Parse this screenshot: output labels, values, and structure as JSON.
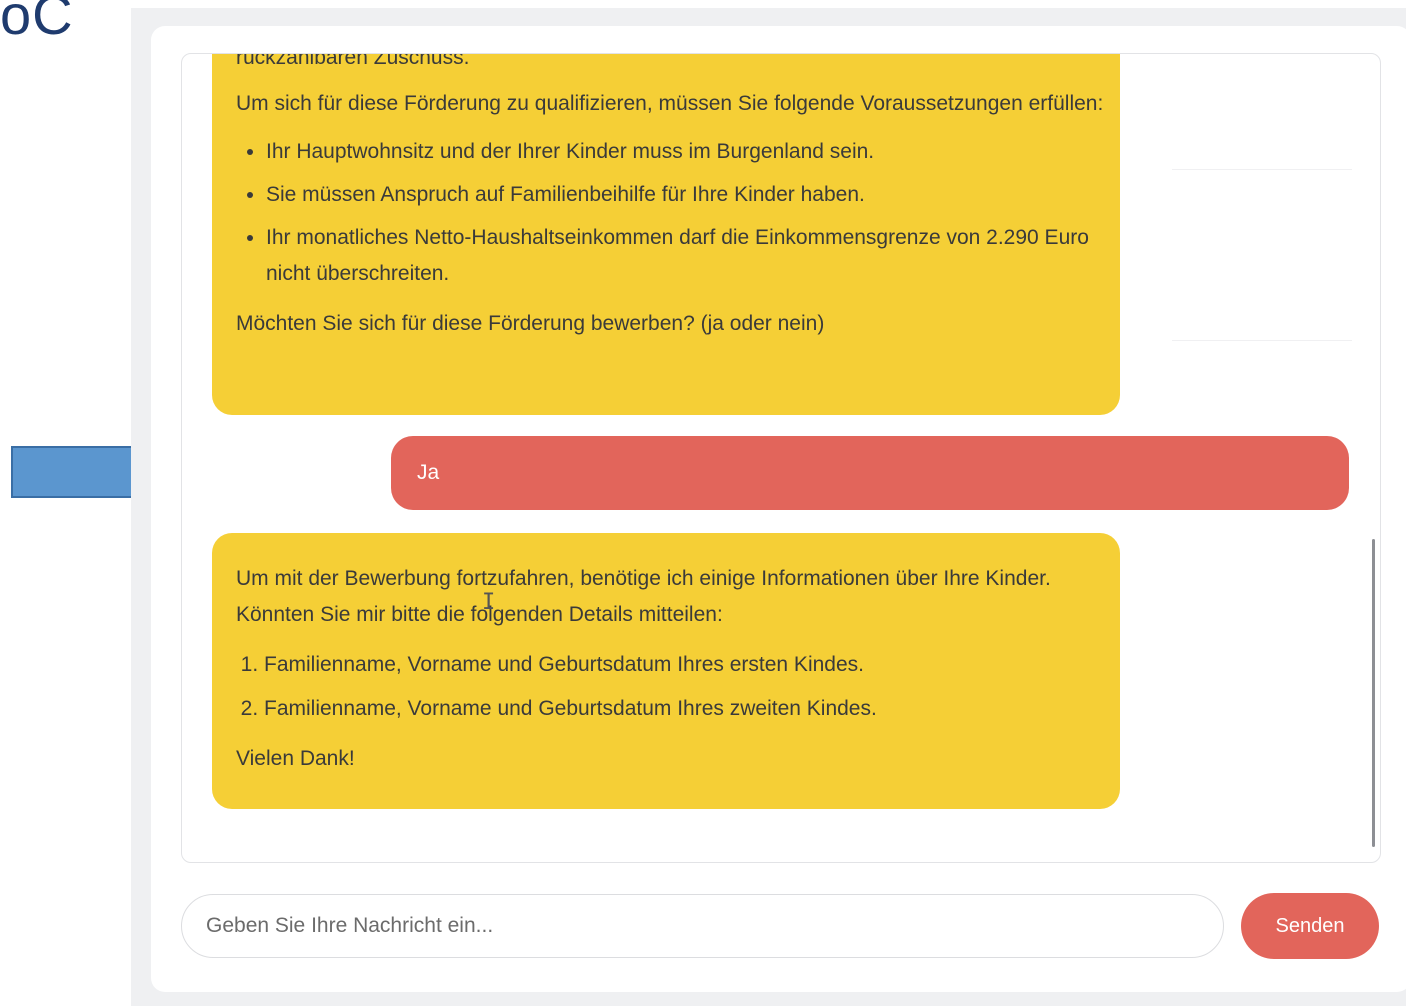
{
  "corner_label": "oC",
  "colors": {
    "bot_bubble": "#f5cf36",
    "user_bubble": "#e2655b",
    "send_button": "#e2655b",
    "arrow": "#5b96cf"
  },
  "messages": {
    "bot1": {
      "clipped_line": "rückzahlbaren Zuschuss.",
      "intro": "Um sich für diese Förderung zu qualifizieren, müssen Sie folgende Voraussetzungen erfüllen:",
      "bullets": [
        "Ihr Hauptwohnsitz und der Ihrer Kinder muss im Burgenland sein.",
        "Sie müssen Anspruch auf Familienbeihilfe für Ihre Kinder haben.",
        "Ihr monatliches Netto-Haushaltseinkommen darf die Einkommensgrenze von 2.290 Euro nicht überschreiten."
      ],
      "question": "Möchten Sie sich für diese Förderung bewerben? (ja oder nein)"
    },
    "user1": {
      "text": "Ja"
    },
    "bot2": {
      "intro": "Um mit der Bewerbung fortzufahren, benötige ich einige Informationen über Ihre Kinder. Könnten Sie mir bitte die folgenden Details mitteilen:",
      "items": [
        "Familienname, Vorname und Geburtsdatum Ihres ersten Kindes.",
        "Familienname, Vorname und Geburtsdatum Ihres zweiten Kindes."
      ],
      "closing": "Vielen Dank!"
    }
  },
  "composer": {
    "placeholder": "Geben Sie Ihre Nachricht ein...",
    "value": "",
    "send_label": "Senden"
  }
}
